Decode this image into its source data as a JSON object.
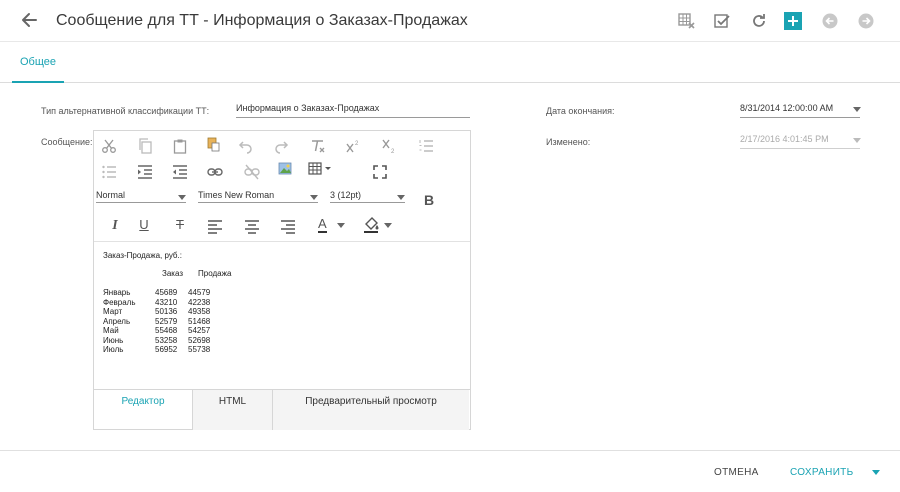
{
  "header": {
    "title": "Сообщение для ТТ - Информация о Заказах-Продажах",
    "accent_color": "#1aa3b3",
    "icons": [
      "back-arrow-icon",
      "grid-clear-icon",
      "checkbox-icon",
      "refresh-icon",
      "plus-icon",
      "previous-record-icon",
      "next-record-icon"
    ]
  },
  "tabs": [
    {
      "label": "Общее",
      "active": true
    }
  ],
  "form": {
    "alt_class_label": "Тип альтернативной классификации ТТ:",
    "alt_class_value": "Информация о Заказах-Продажах",
    "message_label": "Сообщение:",
    "end_date_label": "Дата окончания:",
    "end_date_value": "8/31/2014 12:00:00 AM",
    "changed_label": "Изменено:",
    "changed_value": "2/17/2016 4:01:45 PM"
  },
  "editor": {
    "toolbar": {
      "format_value": "Normal",
      "font_value": "Times New Roman",
      "size_value": "3 (12pt)",
      "bold_label": "B",
      "italic_label": "I",
      "underline_label": "U",
      "strike_label": "T",
      "font_color_label": "A"
    },
    "content": {
      "heading": "Заказ-Продажа, руб.:",
      "columns": [
        "Заказ",
        "Продажа"
      ],
      "rows": [
        {
          "month": "Январь",
          "order": "45689",
          "sale": "44579"
        },
        {
          "month": "Февраль",
          "order": "43210",
          "sale": "42238"
        },
        {
          "month": "Март",
          "order": "50136",
          "sale": "49358"
        },
        {
          "month": "Апрель",
          "order": "52579",
          "sale": "51468"
        },
        {
          "month": "Май",
          "order": "55468",
          "sale": "54257"
        },
        {
          "month": "Июнь",
          "order": "53258",
          "sale": "52698"
        },
        {
          "month": "Июль",
          "order": "56952",
          "sale": "55738"
        }
      ]
    },
    "tabs": [
      {
        "label": "Редактор",
        "active": true
      },
      {
        "label": "HTML",
        "active": false
      },
      {
        "label": "Предварительный просмотр",
        "active": false
      }
    ]
  },
  "footer": {
    "cancel_label": "ОТМЕНА",
    "save_label": "СОХРАНИТЬ"
  }
}
